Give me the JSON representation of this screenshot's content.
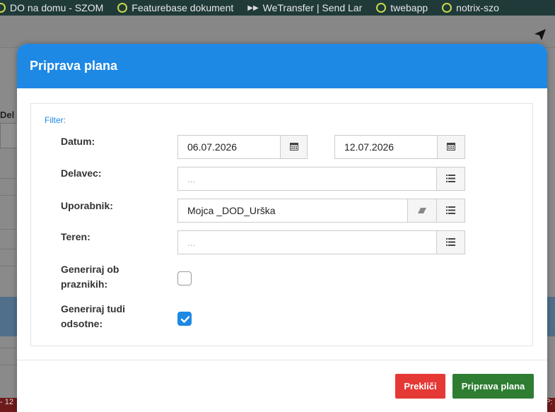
{
  "bookmarks": [
    {
      "label": "DO na domu - SZOM"
    },
    {
      "label": "Featurebase dokument"
    },
    {
      "label": "WeTransfer | Send Lar"
    },
    {
      "label": "twebapp"
    },
    {
      "label": "notrix-szo"
    }
  ],
  "background": {
    "delavec_label_partial": "Del",
    "bottom_left_partial": "- 12",
    "bottom_right_partial": "P:"
  },
  "modal": {
    "title": "Priprava plana",
    "filter_label": "Filter:",
    "datum": {
      "label": "Datum:",
      "from": "06.07.2026",
      "to": "12.07.2026"
    },
    "delavec": {
      "label": "Delavec:",
      "placeholder": "..."
    },
    "uporabnik": {
      "label": "Uporabnik:",
      "value": "Mojca _DOD_Urška"
    },
    "teren": {
      "label": "Teren:",
      "placeholder": "..."
    },
    "generiraj_praznikih": {
      "label_line1": "Generiraj ob",
      "label_line2": "praznikih:",
      "checked": false
    },
    "generiraj_odsotne": {
      "label_line1": "Generiraj tudi",
      "label_line2": "odsotne:",
      "checked": true
    },
    "cancel_label": "Prekliči",
    "submit_label": "Priprava plana"
  },
  "colors": {
    "header": "#1e88e5",
    "cancel": "#e53935",
    "submit": "#2e7d32"
  },
  "icons": {
    "calendar": "calendar-icon",
    "list": "list-icon",
    "eraser": "eraser-icon",
    "send": "paper-plane-icon",
    "check": "check-icon"
  }
}
